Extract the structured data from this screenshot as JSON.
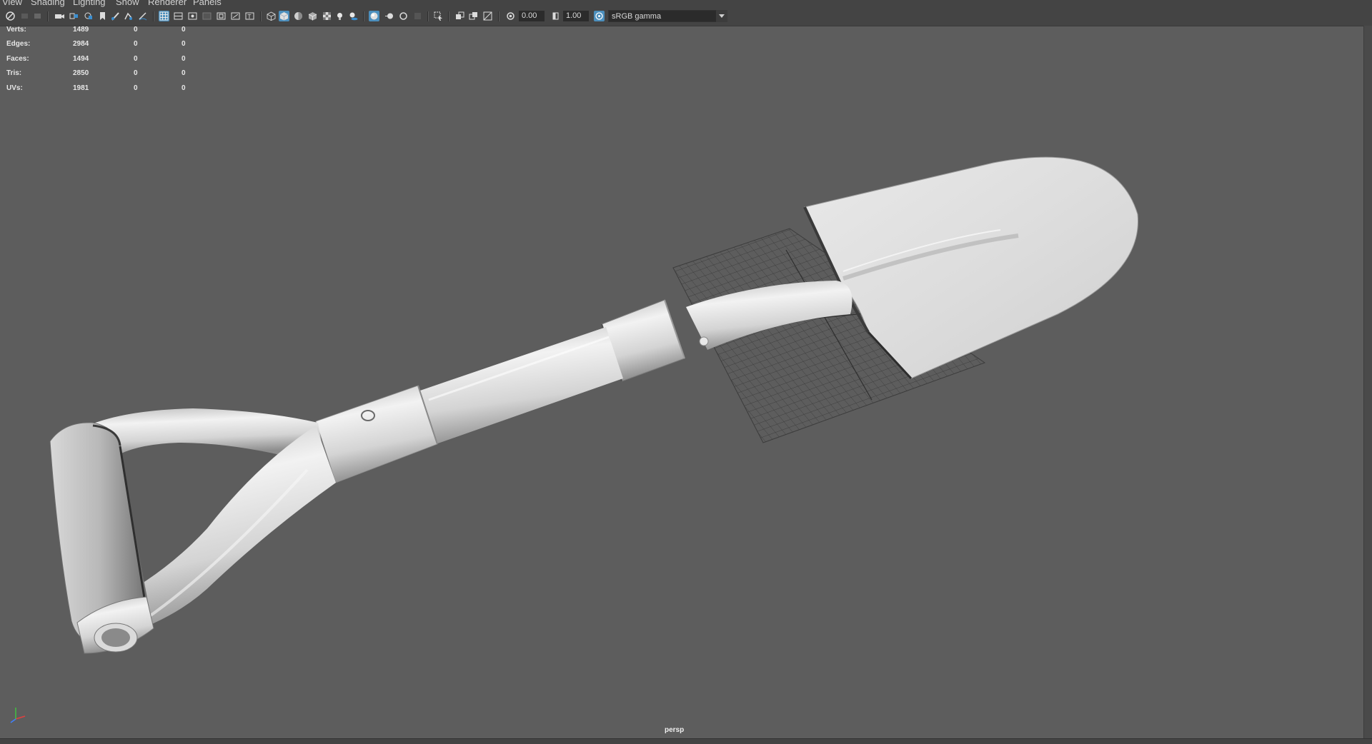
{
  "menu": [
    "View",
    "Shading",
    "Lighting",
    "Show",
    "Renderer",
    "Panels"
  ],
  "toolbar": {
    "exposure_value": "0.00",
    "gamma_value": "1.00",
    "color_management": "sRGB gamma"
  },
  "hud": {
    "rows": [
      {
        "label": "Verts:",
        "v1": "1489",
        "v2": "0",
        "v3": "0"
      },
      {
        "label": "Edges:",
        "v1": "2984",
        "v2": "0",
        "v3": "0"
      },
      {
        "label": "Faces:",
        "v1": "1494",
        "v2": "0",
        "v3": "0"
      },
      {
        "label": "Tris:",
        "v1": "2850",
        "v2": "0",
        "v3": "0"
      },
      {
        "label": "UVs:",
        "v1": "1981",
        "v2": "0",
        "v3": "0"
      }
    ]
  },
  "viewport": {
    "camera": "persp",
    "background_color": "#5d5d5d",
    "model_color": "#d8d8d8"
  },
  "icons": [
    "select-camera-icon",
    "camera-icon",
    "bookmark-icon",
    "grease-pencil-icon",
    "grid-icon",
    "film-gate-icon",
    "resolution-gate-icon",
    "wireframe-icon",
    "smooth-shade-icon",
    "textured-icon",
    "lights-icon",
    "shadows-icon",
    "isolate-icon",
    "xray-icon",
    "exposure-icon",
    "gamma-icon",
    "color-management-icon"
  ]
}
